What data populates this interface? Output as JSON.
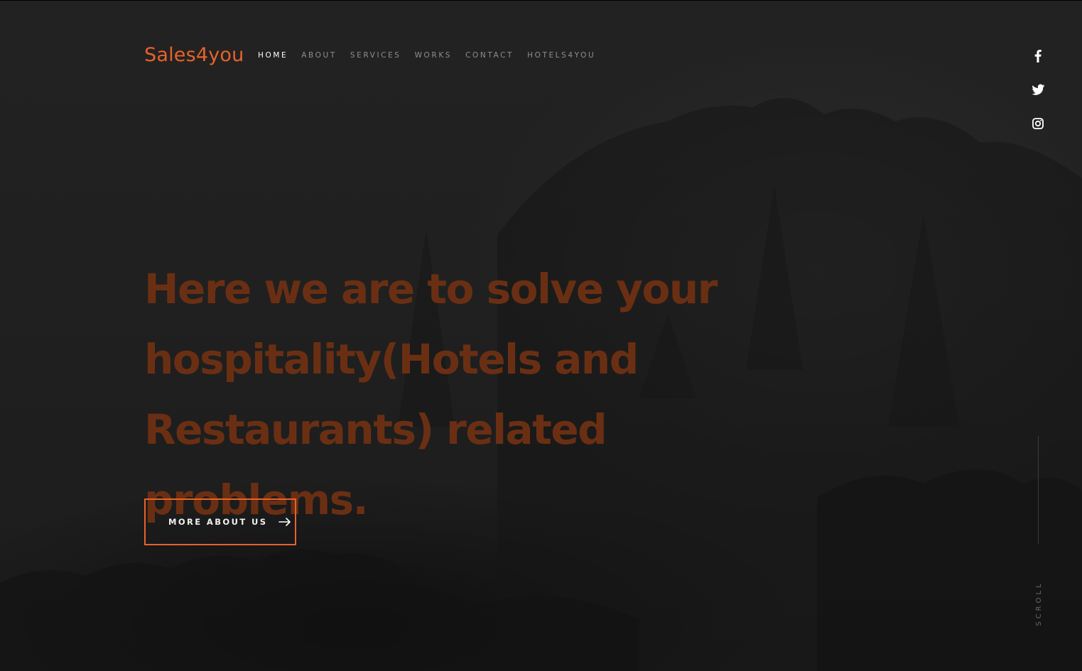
{
  "brand": {
    "logo": "Sales4you",
    "accent_color": "#e8622a"
  },
  "nav": {
    "items": [
      {
        "label": "HOME",
        "active": true
      },
      {
        "label": "ABOUT",
        "active": false
      },
      {
        "label": "SERVICES",
        "active": false
      },
      {
        "label": "WORKS",
        "active": false
      },
      {
        "label": "CONTACT",
        "active": false
      },
      {
        "label": "HOTELS4YOU",
        "active": false
      }
    ]
  },
  "social": [
    "facebook-icon",
    "twitter-icon",
    "instagram-icon"
  ],
  "hero": {
    "headline": "Here we are to solve your hospitality(Hotels and Restaurants) related problems.",
    "headline_color": "#6a2f13",
    "cta_label": "MORE ABOUT US"
  },
  "scroll": {
    "label": "SCROLL"
  }
}
